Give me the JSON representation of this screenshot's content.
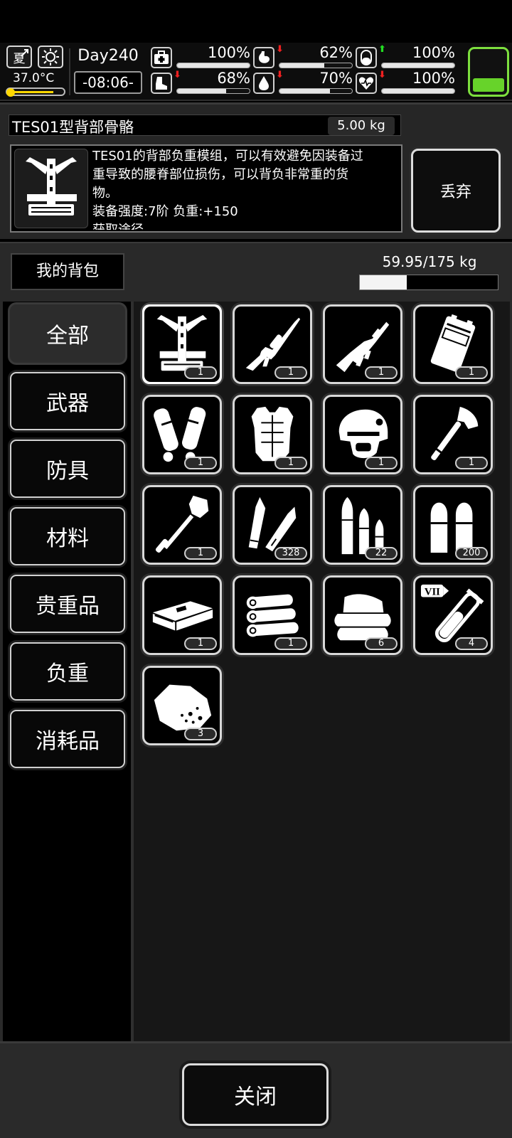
{
  "status": {
    "season": "夏",
    "temperature": "37.0°C",
    "day": "Day240",
    "time": "-08:06-",
    "colors": {
      "up": "#22dd22",
      "down": "#ee2020",
      "battery": "#67d32a",
      "temp": "#ffd800"
    },
    "stats": [
      {
        "icon": "medkit-icon",
        "value": "100%",
        "arrow": "",
        "level": 100
      },
      {
        "icon": "stomach-icon",
        "value": "62%",
        "arrow": "down",
        "level": 62
      },
      {
        "icon": "capsule-icon",
        "value": "100%",
        "arrow": "up",
        "level": 100
      },
      {
        "icon": "boot-icon",
        "value": "68%",
        "arrow": "down",
        "level": 68
      },
      {
        "icon": "water-drop-icon",
        "value": "70%",
        "arrow": "down",
        "level": 70
      },
      {
        "icon": "heart-icon",
        "value": "100%",
        "arrow": "down",
        "level": 100
      }
    ],
    "battery_level": 30
  },
  "detail": {
    "name": "TES01型背部骨骼",
    "weight": "5.00 kg",
    "description_lines": [
      "TES01的背部负重模组，可以有效避免因装备过",
      "重导致的腰脊部位损伤，可以背负非常重的货",
      "物。",
      "装备强度:7阶  负重:+150",
      "获取途径"
    ],
    "discard_label": "丢弃"
  },
  "bag": {
    "title": "我的背包",
    "capacity_text": "59.95/175 kg",
    "capacity_fraction": 0.3426
  },
  "categories": [
    {
      "label": "全部",
      "active": true
    },
    {
      "label": "武器",
      "active": false
    },
    {
      "label": "防具",
      "active": false
    },
    {
      "label": "材料",
      "active": false
    },
    {
      "label": "贵重品",
      "active": false
    },
    {
      "label": "负重",
      "active": false
    },
    {
      "label": "消耗品",
      "active": false
    }
  ],
  "items": [
    {
      "icon": "back-exoskeleton-icon",
      "count": "1",
      "selected": true
    },
    {
      "icon": "sniper-rifle-icon",
      "count": "1",
      "selected": false
    },
    {
      "icon": "assault-rifle-icon",
      "count": "1",
      "selected": false
    },
    {
      "icon": "ammo-box-icon",
      "count": "1",
      "selected": false
    },
    {
      "icon": "shin-guards-icon",
      "count": "1",
      "selected": false
    },
    {
      "icon": "body-armor-icon",
      "count": "1",
      "selected": false
    },
    {
      "icon": "tactical-helmet-icon",
      "count": "1",
      "selected": false
    },
    {
      "icon": "hatchet-icon",
      "count": "1",
      "selected": false
    },
    {
      "icon": "shovel-icon",
      "count": "1",
      "selected": false
    },
    {
      "icon": "rifle-rounds-icon",
      "count": "328",
      "selected": false
    },
    {
      "icon": "assorted-bullets-icon",
      "count": "22",
      "selected": false
    },
    {
      "icon": "pistol-rounds-icon",
      "count": "200",
      "selected": false
    },
    {
      "icon": "cash-stack-icon",
      "count": "1",
      "selected": false
    },
    {
      "icon": "cloth-rolls-icon",
      "count": "1",
      "selected": false
    },
    {
      "icon": "folded-cloth-icon",
      "count": "6",
      "selected": false
    },
    {
      "icon": "test-tube-vii-icon",
      "count": "4",
      "selected": false,
      "tag": "VII"
    },
    {
      "icon": "ore-chunk-icon",
      "count": "3",
      "selected": false
    }
  ],
  "footer": {
    "close_label": "关闭"
  }
}
